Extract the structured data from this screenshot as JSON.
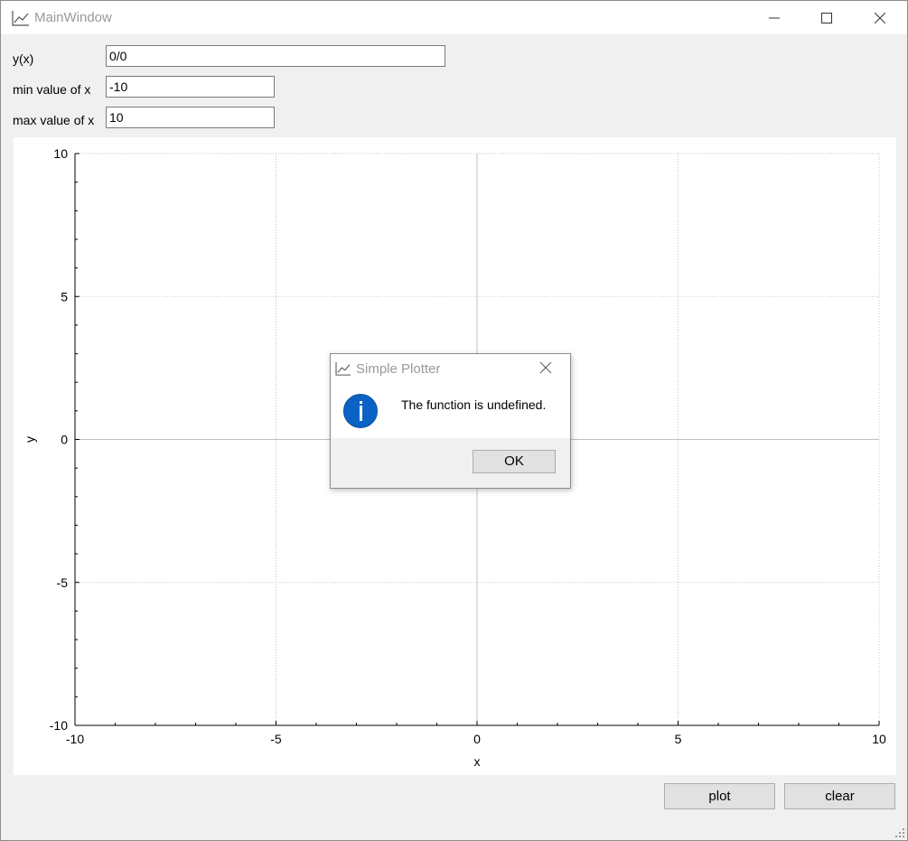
{
  "window": {
    "title": "MainWindow",
    "icon": "line-chart-icon",
    "controls": [
      "minimize-icon",
      "maximize-icon",
      "close-icon"
    ]
  },
  "form": {
    "function_label": "y(x)",
    "function_value": "0/0",
    "min_label": "min value of x",
    "min_value": "-10",
    "max_label": "max value of x",
    "max_value": "10"
  },
  "buttons": {
    "plot": "plot",
    "clear": "clear"
  },
  "chart_data": {
    "type": "line",
    "series": [],
    "xlabel": "x",
    "ylabel": "y",
    "xlim": [
      -10,
      10
    ],
    "ylim": [
      -10,
      10
    ],
    "x_ticks": [
      -10,
      -5,
      0,
      5,
      10
    ],
    "y_ticks": [
      10,
      5,
      0,
      -5,
      -10
    ],
    "x_tick_labels": [
      "-10",
      "-5",
      "0",
      "5",
      "10"
    ],
    "y_tick_labels": [
      "10",
      "5",
      "0",
      "-5",
      "-10"
    ],
    "grid": true
  },
  "dialog": {
    "title": "Simple Plotter",
    "icon": "info-icon",
    "message": "The function is undefined.",
    "ok_label": "OK"
  }
}
